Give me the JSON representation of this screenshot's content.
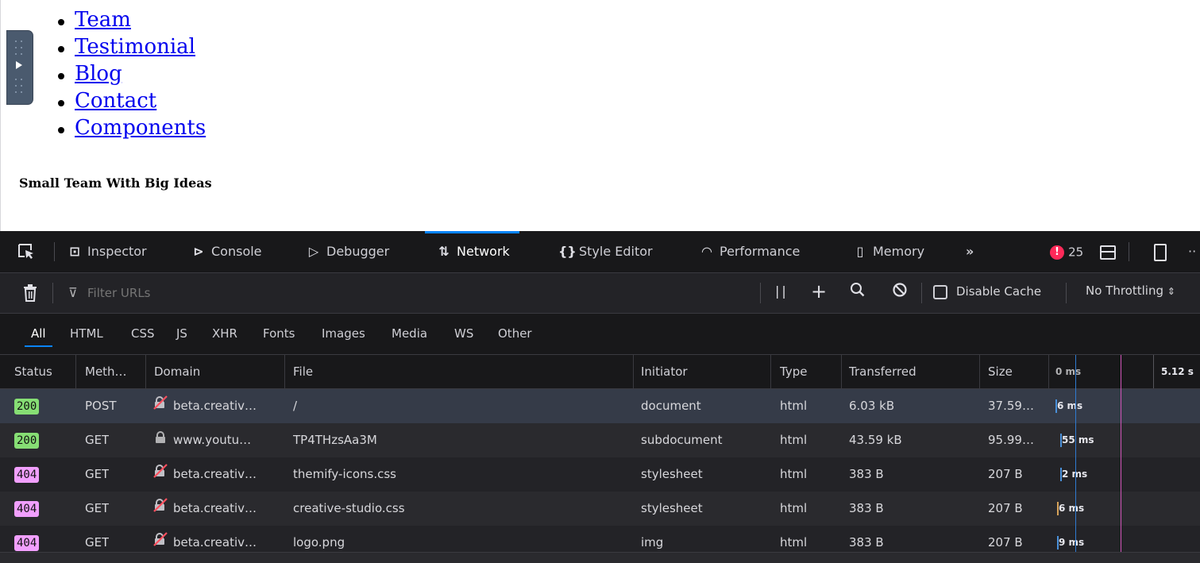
{
  "page": {
    "nav_items": [
      "Team",
      "Testimonial",
      "Blog",
      "Contact",
      "Components"
    ],
    "heading": "Small Team With Big Ideas"
  },
  "devtools": {
    "tabs": [
      {
        "label": "Inspector",
        "icon": "inspector-icon"
      },
      {
        "label": "Console",
        "icon": "console-icon"
      },
      {
        "label": "Debugger",
        "icon": "debugger-icon"
      },
      {
        "label": "Network",
        "icon": "network-icon",
        "active": true
      },
      {
        "label": "Style Editor",
        "icon": "style-editor-icon"
      },
      {
        "label": "Performance",
        "icon": "performance-icon"
      },
      {
        "label": "Memory",
        "icon": "memory-icon"
      }
    ],
    "error_count": "25",
    "toolbar": {
      "filter_placeholder": "Filter URLs",
      "disable_cache_label": "Disable Cache",
      "throttling": "No Throttling"
    },
    "filter_tabs": [
      "All",
      "HTML",
      "CSS",
      "JS",
      "XHR",
      "Fonts",
      "Images",
      "Media",
      "WS",
      "Other"
    ],
    "columns": [
      "Status",
      "Meth…",
      "Domain",
      "File",
      "Initiator",
      "Type",
      "Transferred",
      "Size"
    ],
    "timeline": {
      "start": "0 ms",
      "end": "5.12 s"
    },
    "requests": [
      {
        "status": "200",
        "method": "POST",
        "domain": "beta.creativ…",
        "file": "/",
        "initiator": "document",
        "type": "html",
        "transferred": "6.03 kB",
        "size": "37.59…",
        "timing": "6 ms",
        "secure": false
      },
      {
        "status": "200",
        "method": "GET",
        "domain": "www.youtu…",
        "file": "TP4THzsAa3M",
        "initiator": "subdocument",
        "type": "html",
        "transferred": "43.59 kB",
        "size": "95.99…",
        "timing": "55 ms",
        "secure": true
      },
      {
        "status": "404",
        "method": "GET",
        "domain": "beta.creativ…",
        "file": "themify-icons.css",
        "initiator": "stylesheet",
        "type": "html",
        "transferred": "383 B",
        "size": "207 B",
        "timing": "2 ms",
        "secure": false
      },
      {
        "status": "404",
        "method": "GET",
        "domain": "beta.creativ…",
        "file": "creative-studio.css",
        "initiator": "stylesheet",
        "type": "html",
        "transferred": "383 B",
        "size": "207 B",
        "timing": "6 ms",
        "secure": false
      },
      {
        "status": "404",
        "method": "GET",
        "domain": "beta.creativ…",
        "file": "logo.png",
        "initiator": "img",
        "type": "html",
        "transferred": "383 B",
        "size": "207 B",
        "timing": "9 ms",
        "secure": false
      }
    ],
    "colors": {
      "ok": "#86de74",
      "not_found": "#f19ffe",
      "accent": "#0a84ff",
      "error": "#ff2a59"
    }
  }
}
